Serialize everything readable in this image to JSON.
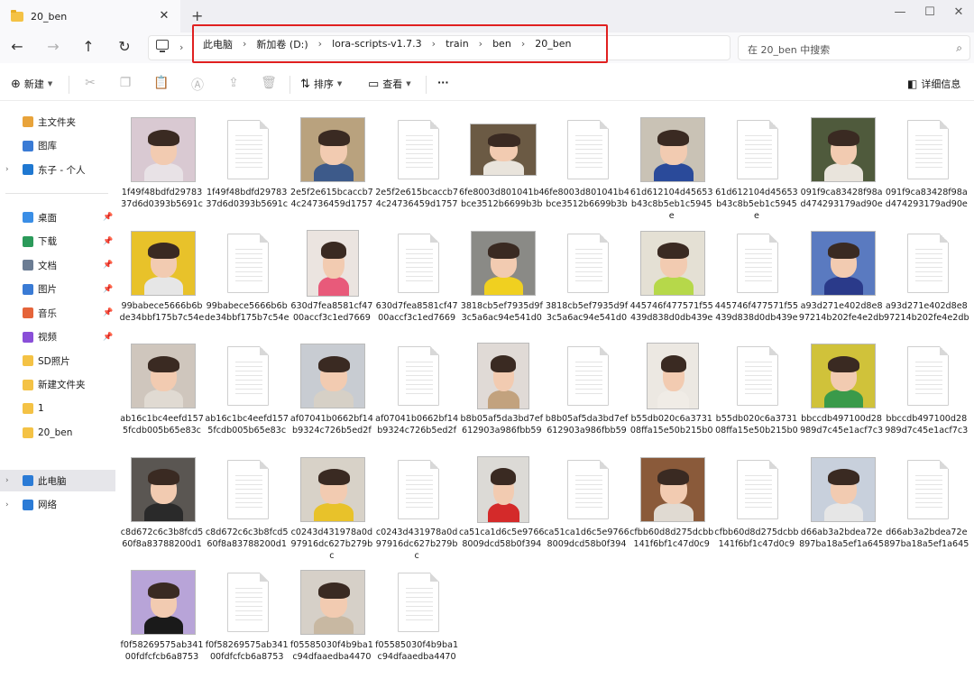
{
  "window": {
    "tab_title": "20_ben",
    "new_tab": "+",
    "controls": {
      "minimize": "—",
      "maximize": "☐",
      "close": "✕"
    }
  },
  "nav": {
    "back": "←",
    "forward": "→",
    "up": "↑",
    "refresh": "↻"
  },
  "breadcrumb": [
    "此电脑",
    "新加卷 (D:)",
    "lora-scripts-v1.7.3",
    "train",
    "ben",
    "20_ben"
  ],
  "search": {
    "placeholder": "在 20_ben 中搜索"
  },
  "toolbar": {
    "new_label": "新建",
    "sort_label": "排序",
    "view_label": "查看",
    "more_label": "···",
    "details_label": "详细信息"
  },
  "sidebar": {
    "top_items": [
      {
        "label": "主文件夹",
        "icon": "home-icon",
        "color": "#e8a33a"
      },
      {
        "label": "图库",
        "icon": "gallery-icon",
        "color": "#3a7bd5"
      },
      {
        "label": "东子 - 个人",
        "icon": "onedrive-icon",
        "color": "#1f78d1"
      }
    ],
    "quick_items": [
      {
        "label": "桌面",
        "icon": "desktop-icon",
        "color": "#3a8ee6",
        "pinned": true
      },
      {
        "label": "下载",
        "icon": "download-icon",
        "color": "#2b9a5a",
        "pinned": true
      },
      {
        "label": "文档",
        "icon": "document-icon",
        "color": "#6b7c93",
        "pinned": true
      },
      {
        "label": "图片",
        "icon": "picture-icon",
        "color": "#3a7bd5",
        "pinned": true
      },
      {
        "label": "音乐",
        "icon": "music-icon",
        "color": "#e5643a",
        "pinned": true
      },
      {
        "label": "视频",
        "icon": "video-icon",
        "color": "#8a4fd8",
        "pinned": true
      },
      {
        "label": "SD照片",
        "icon": "folder-icon",
        "color": "#f4c245",
        "pinned": false
      },
      {
        "label": "新建文件夹",
        "icon": "folder-icon",
        "color": "#f4c245",
        "pinned": false
      },
      {
        "label": "1",
        "icon": "folder-icon",
        "color": "#f4c245",
        "pinned": false
      },
      {
        "label": "20_ben",
        "icon": "folder-icon",
        "color": "#f4c245",
        "pinned": false
      }
    ],
    "bottom_items": [
      {
        "label": "此电脑",
        "icon": "this-pc-icon",
        "color": "#2b7bd6",
        "selected": true
      },
      {
        "label": "网络",
        "icon": "network-icon",
        "color": "#2b7bd6",
        "selected": false
      }
    ]
  },
  "files": [
    {
      "name": "1f49f48bdfd2978337d6d0393b5691c",
      "type": "image",
      "bg": "#d9c9d2",
      "shirt": "#e8e2e6",
      "shape": "square"
    },
    {
      "name": "1f49f48bdfd2978337d6d0393b5691c",
      "type": "text"
    },
    {
      "name": "2e5f2e615bcaccb74c24736459d1757",
      "type": "image",
      "bg": "#b9a27e",
      "shirt": "#3d5a8a",
      "shape": "square"
    },
    {
      "name": "2e5f2e615bcaccb74c24736459d1757",
      "type": "text"
    },
    {
      "name": "6fe8003d801041b4bce3512b6699b3b",
      "type": "image",
      "bg": "#6b5a44",
      "shirt": "#e9e4dc",
      "shape": "wide"
    },
    {
      "name": "6fe8003d801041b4bce3512b6699b3b",
      "type": "text"
    },
    {
      "name": "61d612104d45653b43c8b5eb1c5945e",
      "type": "image",
      "bg": "#c9c2b5",
      "shirt": "#2a4a9a",
      "shape": "square"
    },
    {
      "name": "61d612104d45653b43c8b5eb1c5945e",
      "type": "text"
    },
    {
      "name": "091f9ca83428f98ad474293179ad90e",
      "type": "image",
      "bg": "#4f5a3c",
      "shirt": "#e9e4dc",
      "shape": "square"
    },
    {
      "name": "091f9ca83428f98ad474293179ad90e",
      "type": "text"
    },
    {
      "name": "99babece5666b6bde34bbf175b7c54e",
      "type": "image",
      "bg": "#e8c22a",
      "shirt": "#e6e6e6",
      "shape": "square"
    },
    {
      "name": "99babece5666b6bde34bbf175b7c54e",
      "type": "text"
    },
    {
      "name": "630d7fea8581cf4700accf3c1ed7669",
      "type": "image",
      "bg": "#ebe4e0",
      "shirt": "#e85a7a",
      "shape": "tall"
    },
    {
      "name": "630d7fea8581cf4700accf3c1ed7669",
      "type": "text"
    },
    {
      "name": "3818cb5ef7935d9f3c5a6ac94e541d0",
      "type": "image",
      "bg": "#8a8a86",
      "shirt": "#f0d020",
      "shape": "square"
    },
    {
      "name": "3818cb5ef7935d9f3c5a6ac94e541d0",
      "type": "text"
    },
    {
      "name": "445746f477571f55439d838d0db439e",
      "type": "image",
      "bg": "#e4e0d4",
      "shirt": "#b6d84a",
      "shape": "square"
    },
    {
      "name": "445746f477571f55439d838d0db439e",
      "type": "text"
    },
    {
      "name": "a93d271e402d8e897214b202fe4e2db",
      "type": "image",
      "bg": "#5a7ac0",
      "shirt": "#2a3a8a",
      "shape": "square"
    },
    {
      "name": "a93d271e402d8e897214b202fe4e2db",
      "type": "text"
    },
    {
      "name": "ab16c1bc4eefd1575fcdb005b65e83c",
      "type": "image",
      "bg": "#cfc6bd",
      "shirt": "#e0dad2",
      "shape": "square"
    },
    {
      "name": "ab16c1bc4eefd1575fcdb005b65e83c",
      "type": "text"
    },
    {
      "name": "af07041b0662bf14b9324c726b5ed2f",
      "type": "image",
      "bg": "#c8ccd2",
      "shirt": "#d6d0c6",
      "shape": "square"
    },
    {
      "name": "af07041b0662bf14b9324c726b5ed2f",
      "type": "text"
    },
    {
      "name": "b8b05af5da3bd7ef612903a986fbb59",
      "type": "image",
      "bg": "#e0dad6",
      "shirt": "#c2a27e",
      "shape": "tall"
    },
    {
      "name": "b8b05af5da3bd7ef612903a986fbb59",
      "type": "text"
    },
    {
      "name": "b55db020c6a373108ffa15e50b215b0",
      "type": "image",
      "bg": "#ece8e2",
      "shirt": "#f0ece6",
      "shape": "tall"
    },
    {
      "name": "b55db020c6a373108ffa15e50b215b0",
      "type": "text"
    },
    {
      "name": "bbccdb497100d28989d7c45e1acf7c3",
      "type": "image",
      "bg": "#d0c23a",
      "shirt": "#3a9a4a",
      "shape": "square"
    },
    {
      "name": "bbccdb497100d28989d7c45e1acf7c3",
      "type": "text"
    },
    {
      "name": "c8d672c6c3b8fcd560f8a83788200d1",
      "type": "image",
      "bg": "#5a5652",
      "shirt": "#2a2a2a",
      "shape": "square"
    },
    {
      "name": "c8d672c6c3b8fcd560f8a83788200d1",
      "type": "text"
    },
    {
      "name": "c0243d431978a0d97916dc627b279bc",
      "type": "image",
      "bg": "#d8d2c8",
      "shirt": "#e8c22a",
      "shape": "square"
    },
    {
      "name": "c0243d431978a0d97916dc627b279bc",
      "type": "text"
    },
    {
      "name": "ca51ca1d6c5e97668009dcd58b0f394",
      "type": "image",
      "bg": "#dcdad6",
      "shirt": "#d42a2a",
      "shape": "tall"
    },
    {
      "name": "ca51ca1d6c5e97668009dcd58b0f394",
      "type": "text"
    },
    {
      "name": "cfbb60d8d275dcbb141f6bf1c47d0c9",
      "type": "image",
      "bg": "#8a5a3a",
      "shirt": "#e0dad2",
      "shape": "square"
    },
    {
      "name": "cfbb60d8d275dcbb141f6bf1c47d0c9",
      "type": "text"
    },
    {
      "name": "d66ab3a2bdea72e897ba18a5ef1a645",
      "type": "image",
      "bg": "#c8d0dc",
      "shirt": "#e6e6e6",
      "shape": "square"
    },
    {
      "name": "d66ab3a2bdea72e897ba18a5ef1a645",
      "type": "text"
    },
    {
      "name": "f0f58269575ab34100fdfcfcb6a8753",
      "type": "image",
      "bg": "#b8a4d8",
      "shirt": "#1a1a1a",
      "shape": "square"
    },
    {
      "name": "f0f58269575ab34100fdfcfcb6a8753",
      "type": "text"
    },
    {
      "name": "f05585030f4b9ba1c94dfaaedba4470",
      "type": "image",
      "bg": "#d6d0c8",
      "shirt": "#c8b8a2",
      "shape": "square"
    },
    {
      "name": "f05585030f4b9ba1c94dfaaedba4470",
      "type": "text"
    }
  ]
}
